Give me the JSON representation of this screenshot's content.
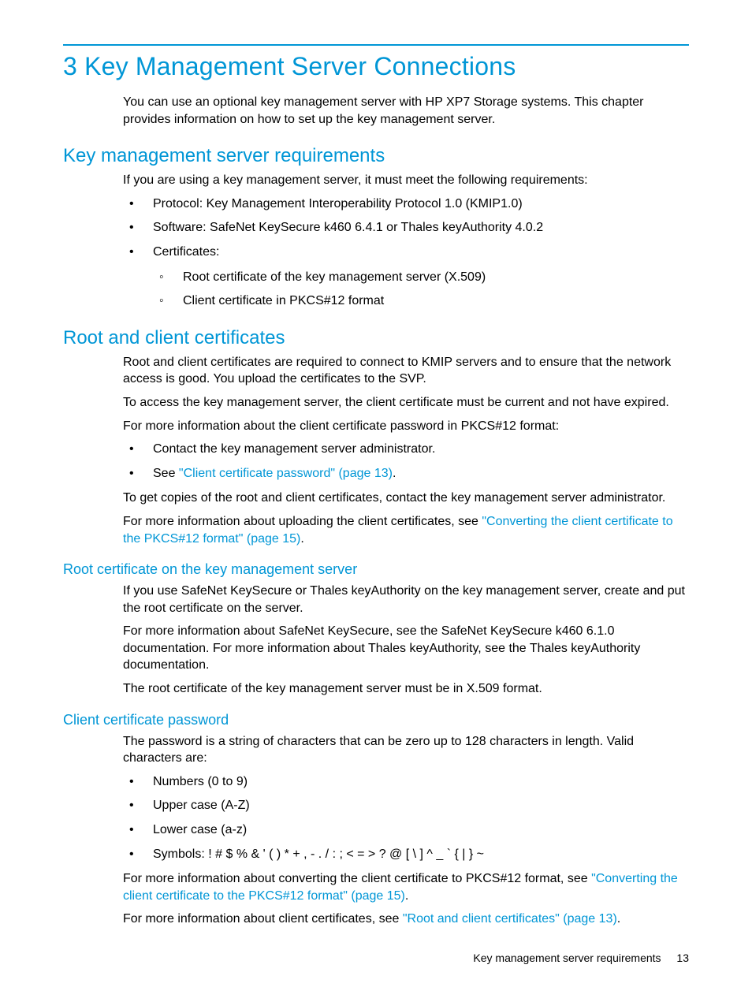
{
  "chapter_title": "3 Key Management Server Connections",
  "intro": "You can use an optional key management server with HP XP7 Storage systems. This chapter provides information on how to set up the key management server.",
  "sec_requirements": {
    "heading": "Key management server requirements",
    "lead": "If you are using a key management server, it must meet the following requirements:",
    "items": {
      "protocol": "Protocol: Key Management Interoperability Protocol 1.0 (KMIP1.0)",
      "software": "Software: SafeNet KeySecure k460 6.4.1 or Thales keyAuthority 4.0.2",
      "certs_label": "Certificates:",
      "cert_root": "Root certificate of the key management server (X.509)",
      "cert_client": "Client certificate in PKCS#12 format"
    }
  },
  "sec_rootclient": {
    "heading": "Root and client certificates",
    "p1": "Root and client certificates are required to connect to KMIP servers and to ensure that the network access is good. You upload the certificates to the SVP.",
    "p2": "To access the key management server, the client certificate must be current and not have expired.",
    "p3": "For more information about the client certificate password in PKCS#12 format:",
    "b1": "Contact the key management server administrator.",
    "b2_prefix": "See ",
    "b2_link": "\"Client certificate password\" (page 13)",
    "b2_suffix": ".",
    "p4": "To get copies of the root and client certificates, contact the key management server administrator.",
    "p5_prefix": "For more information about uploading the client certificates, see ",
    "p5_link": "\"Converting the client certificate to the PKCS#12 format\" (page 15)",
    "p5_suffix": "."
  },
  "sec_rootcert": {
    "heading": "Root certificate on the key management server",
    "p1": "If you use SafeNet KeySecure or Thales keyAuthority on the key management server, create and put the root certificate on the server.",
    "p2": "For more information about SafeNet KeySecure, see the SafeNet KeySecure k460 6.1.0 documentation. For more information about Thales keyAuthority, see the Thales keyAuthority documentation.",
    "p3": "The root certificate of the key management server must be in X.509 format."
  },
  "sec_password": {
    "heading": "Client certificate password",
    "p1": "The password is a string of characters that can be zero up to 128 characters in length. Valid characters are:",
    "b1": "Numbers (0 to 9)",
    "b2": "Upper case (A-Z)",
    "b3": "Lower case (a-z)",
    "b4": "Symbols: ! # $ % & ' ( ) * + , - . / : ; < = > ? @ [ \\ ] ^ _ ` { | } ~",
    "p2_prefix": "For more information about converting the client certificate to PKCS#12 format, see ",
    "p2_link": "\"Converting the client certificate to the PKCS#12 format\" (page 15)",
    "p2_suffix": ".",
    "p3_prefix": "For more information about client certificates, see ",
    "p3_link": "\"Root and client certificates\" (page 13)",
    "p3_suffix": "."
  },
  "footer": {
    "title": "Key management server requirements",
    "page": "13"
  }
}
